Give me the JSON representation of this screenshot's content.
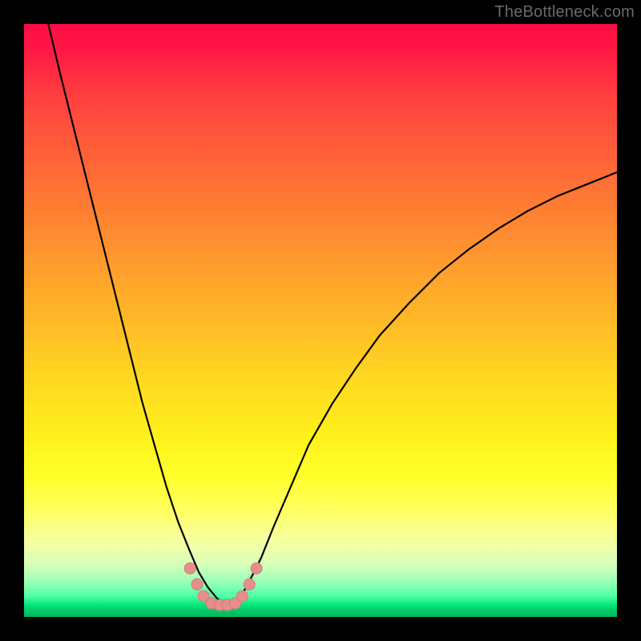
{
  "watermark": {
    "text": "TheBottleneck.com"
  },
  "colors": {
    "curve_stroke": "#000000",
    "marker_fill": "#e48f8b",
    "marker_stroke": "#d97a76",
    "frame_bg": "#000000"
  },
  "chart_data": {
    "type": "line",
    "title": "",
    "xlabel": "",
    "ylabel": "",
    "xlim": [
      0,
      100
    ],
    "ylim": [
      0,
      100
    ],
    "grid": false,
    "legend": false,
    "curve_left": {
      "x": [
        4.1,
        6,
        8,
        10,
        12,
        14,
        16,
        18,
        20,
        22,
        24,
        26,
        28,
        29.5,
        31,
        32.5,
        34,
        35.1
      ],
      "y": [
        100,
        92,
        84,
        76,
        68,
        60,
        52,
        44,
        36,
        29,
        22,
        16,
        11,
        7.5,
        5,
        3.2,
        2,
        2
      ]
    },
    "curve_right": {
      "x": [
        35.1,
        36.5,
        38,
        40,
        42,
        45,
        48,
        52,
        56,
        60,
        65,
        70,
        75,
        80,
        85,
        90,
        95,
        100
      ],
      "y": [
        2,
        3.3,
        6,
        10,
        15,
        22,
        29,
        36,
        42,
        47.5,
        53,
        58,
        62,
        65.5,
        68.5,
        71,
        73,
        75
      ]
    },
    "markers": [
      {
        "x": 28.0,
        "y": 8.2
      },
      {
        "x": 29.2,
        "y": 5.5
      },
      {
        "x": 30.3,
        "y": 3.5
      },
      {
        "x": 31.6,
        "y": 2.3
      },
      {
        "x": 33.0,
        "y": 2.0
      },
      {
        "x": 34.3,
        "y": 2.0
      },
      {
        "x": 35.6,
        "y": 2.3
      },
      {
        "x": 36.8,
        "y": 3.5
      },
      {
        "x": 38.0,
        "y": 5.5
      },
      {
        "x": 39.2,
        "y": 8.2
      }
    ],
    "marker_radius_px": 7
  }
}
